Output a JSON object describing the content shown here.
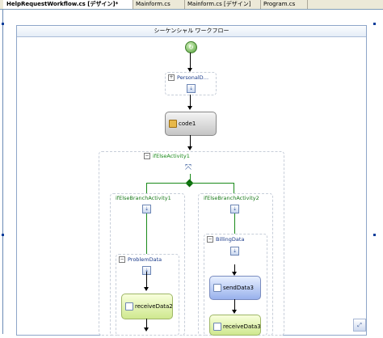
{
  "tabs": [
    {
      "label": "HelpRequestWorkflow.cs [デザイン]*",
      "active": true
    },
    {
      "label": "Mainform.cs",
      "active": false
    },
    {
      "label": "Mainform.cs [デザイン]",
      "active": false
    },
    {
      "label": "Program.cs",
      "active": false
    }
  ],
  "designer": {
    "title": "シーケンシャル ワークフロー",
    "personal": {
      "label": "PersonalD…"
    },
    "code": {
      "label": "code1"
    },
    "ifelse": {
      "label": "ifElseActivity1",
      "branch1": {
        "label": "ifElseBranchActivity1",
        "seq": {
          "label": "ProblemData",
          "activity": "receiveData2"
        }
      },
      "branch2": {
        "label": "ifElseBranchActivity2",
        "seq": {
          "label": "BillingData",
          "activity1": "sendData3",
          "activity2": "receiveData3"
        }
      }
    },
    "colors": {
      "accent": "#1a8a1a",
      "link": "#1a3a8a",
      "border": "#8ea6c9"
    }
  }
}
